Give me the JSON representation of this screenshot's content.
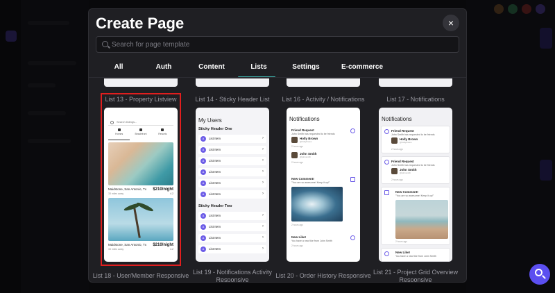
{
  "modal": {
    "title": "Create Page",
    "close_label": "×",
    "search_placeholder": "Search for page template"
  },
  "tabs": [
    "All",
    "Auth",
    "Content",
    "Lists",
    "Settings",
    "E-commerce"
  ],
  "active_tab": "Lists",
  "accent_color": "#3fb6b0",
  "selection_color": "#e01e1e",
  "templates": [
    {
      "name": "List 13 - Property Listview",
      "selected": true
    },
    {
      "name": "List 14 - Sticky Header List",
      "selected": false
    },
    {
      "name": "List 16 - Activity / Notifications",
      "selected": false
    },
    {
      "name": "List 17 - Notifications",
      "selected": false
    }
  ],
  "next_templates": [
    "List 18 - User/Member Responsive",
    "List 19 - Notifications Activity Responsive",
    "List 20 - Order History Responsive",
    "List 21 - Project Grid Overview Responsive"
  ],
  "property": {
    "search": "Search listings...",
    "nav": [
      "Homes",
      "Beachfront",
      "Resorts"
    ],
    "listings": [
      {
        "location": "Maidstone, San Antonio, Tx",
        "price": "$210/night",
        "distance": "33 miles away",
        "rating": "4.2"
      },
      {
        "location": "Maidstone, San Antonio, Tx",
        "price": "$210/night",
        "distance": "33 miles away",
        "rating": "4.2"
      }
    ]
  },
  "sticky": {
    "title": "My Users",
    "header_one": "Sticky Header One",
    "header_two": "Sticky Header Two",
    "item_label": "List Item",
    "avatar_letter": "A",
    "chevron": "›"
  },
  "notifications": {
    "title": "Notifications",
    "friend_request": "Friend Request",
    "friend_request_desc": "John Smith has requested to be friends",
    "time": "2 hours ago",
    "person1_name": "Holly Brown",
    "person1_handle": "@hollybrown",
    "person2_name": "John Smith",
    "person2_handle": "@johnsmith",
    "new_comment": "New Comment!",
    "comment_text": "\"You are so awesome! Keep it up!\"",
    "new_like": "New Like!",
    "like_text": "You have a new like from John Smith"
  }
}
